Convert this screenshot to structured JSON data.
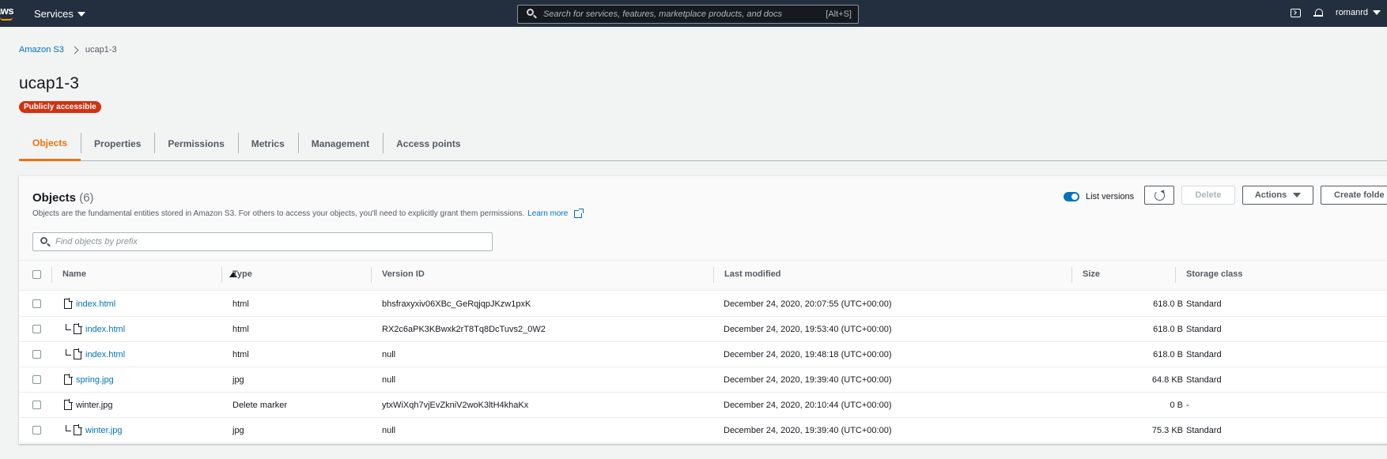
{
  "nav": {
    "logo": "aws",
    "services": "Services",
    "search_placeholder": "Search for services, features, marketplace products, and docs",
    "search_shortcut": "[Alt+S]",
    "user": "romanrd"
  },
  "breadcrumb": {
    "root": "Amazon S3",
    "current": "ucap1-3"
  },
  "page": {
    "title": "ucap1-3",
    "badge": "Publicly accessible"
  },
  "tabs": [
    "Objects",
    "Properties",
    "Permissions",
    "Metrics",
    "Management",
    "Access points"
  ],
  "objects": {
    "title": "Objects",
    "count": "(6)",
    "description": "Objects are the fundamental entities stored in Amazon S3. For others to access your objects, you'll need to explicitly grant them permissions.",
    "learn_more": "Learn more",
    "filter_placeholder": "Find objects by prefix",
    "list_versions_label": "List versions",
    "list_versions_on": true,
    "delete_label": "Delete",
    "actions_label": "Actions",
    "create_label": "Create folde"
  },
  "table": {
    "headers": [
      "Name",
      "Type",
      "Version ID",
      "Last modified",
      "Size",
      "Storage class"
    ],
    "rows": [
      {
        "name": "index.html",
        "version_child": false,
        "link": true,
        "type": "html",
        "version": "bhsfraxyxiv06XBc_GeRqjqpJKzw1pxK",
        "modified": "December 24, 2020, 20:07:55 (UTC+00:00)",
        "size": "618.0 B",
        "storage": "Standard"
      },
      {
        "name": "index.html",
        "version_child": true,
        "link": true,
        "type": "html",
        "version": "RX2c6aPK3KBwxk2rT8Tq8DcTuvs2_0W2",
        "modified": "December 24, 2020, 19:53:40 (UTC+00:00)",
        "size": "618.0 B",
        "storage": "Standard"
      },
      {
        "name": "index.html",
        "version_child": true,
        "link": true,
        "type": "html",
        "version": "null",
        "modified": "December 24, 2020, 19:48:18 (UTC+00:00)",
        "size": "618.0 B",
        "storage": "Standard"
      },
      {
        "name": "spring.jpg",
        "version_child": false,
        "link": true,
        "type": "jpg",
        "version": "null",
        "modified": "December 24, 2020, 19:39:40 (UTC+00:00)",
        "size": "64.8 KB",
        "storage": "Standard"
      },
      {
        "name": "winter.jpg",
        "version_child": false,
        "link": false,
        "type": "Delete marker",
        "version": "ytxWiXqh7vjEvZkniV2woK3ltH4khaKx",
        "modified": "December 24, 2020, 20:10:44 (UTC+00:00)",
        "size": "0 B",
        "storage": "-"
      },
      {
        "name": "winter.jpg",
        "version_child": true,
        "link": true,
        "type": "jpg",
        "version": "null",
        "modified": "December 24, 2020, 19:39:40 (UTC+00:00)",
        "size": "75.3 KB",
        "storage": "Standard"
      }
    ]
  }
}
